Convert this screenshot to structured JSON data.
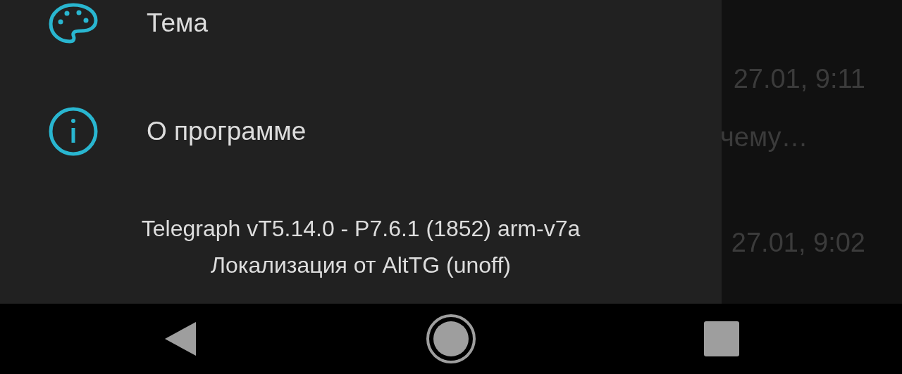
{
  "drawer": {
    "menu_items": [
      {
        "kind": "palette",
        "label": "Тема"
      },
      {
        "kind": "info",
        "label": "О программе"
      }
    ],
    "footer": [
      "Telegraph vT5.14.0 - P7.6.1 (1852) arm-v7a",
      "Локализация от AltTG (unoff)"
    ]
  },
  "background_chat": {
    "texts": [
      {
        "kind": "time",
        "text": "27.01, 9:11"
      },
      {
        "kind": "preview",
        "text": "чему…"
      },
      {
        "kind": "time",
        "text": "27.01, 9:02"
      }
    ]
  },
  "nav_bar": {
    "buttons": [
      {
        "kind": "back"
      },
      {
        "kind": "home"
      },
      {
        "kind": "recents"
      }
    ]
  }
}
